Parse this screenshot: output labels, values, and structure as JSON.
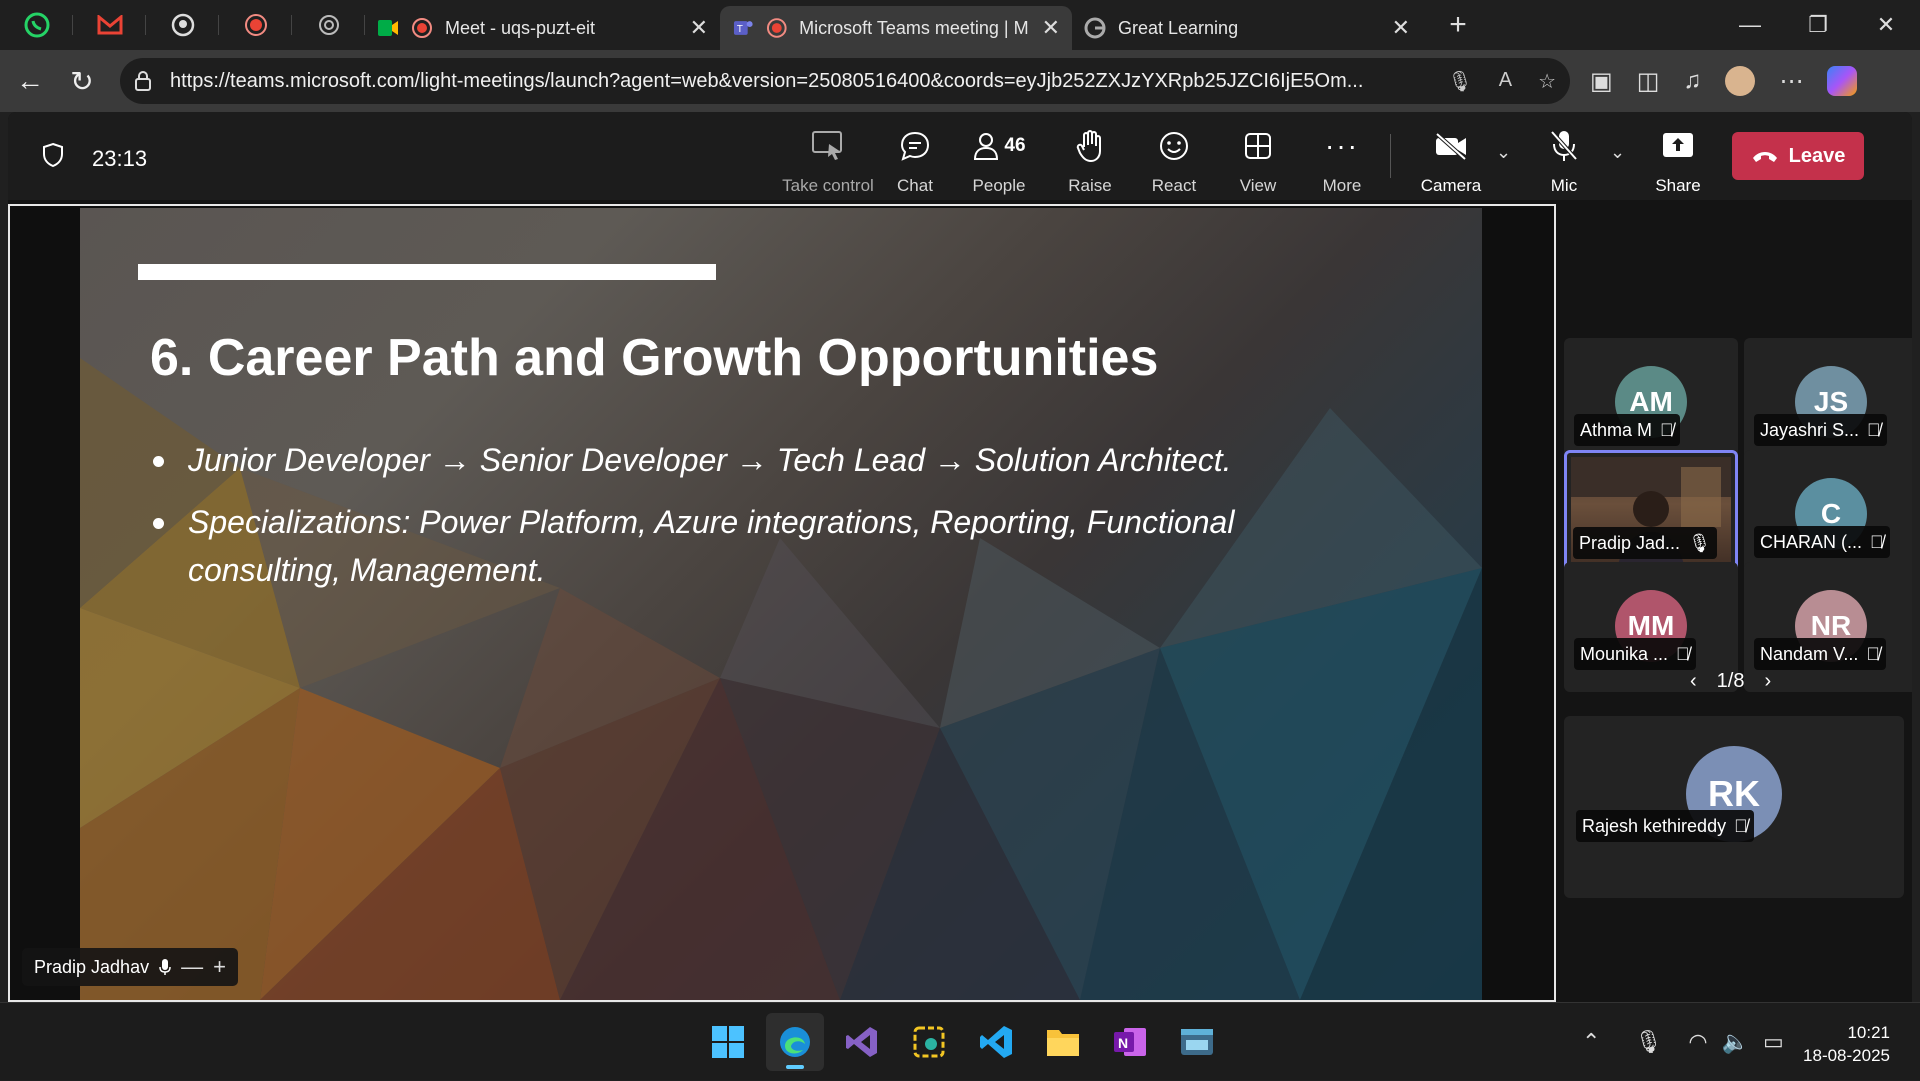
{
  "browser": {
    "tabs": [
      {
        "title": "Meet - uqs-puzt-eit",
        "active": false
      },
      {
        "title": "Microsoft Teams meeting | M",
        "active": true
      },
      {
        "title": "Great Learning",
        "active": false
      }
    ],
    "url": "https://teams.microsoft.com/light-meetings/launch?agent=web&version=25080516400&coords=eyJjb252ZXJzYXRpb25JZCI6IjE5Om..."
  },
  "meeting": {
    "timer": "23:13",
    "controls": {
      "take_control": "Take control",
      "chat": "Chat",
      "people": "People",
      "people_count": "46",
      "raise": "Raise",
      "react": "React",
      "view": "View",
      "more": "More",
      "camera": "Camera",
      "mic": "Mic",
      "share": "Share",
      "leave": "Leave"
    }
  },
  "slide": {
    "heading": "6. Career Path and Growth Opportunities",
    "bullets": [
      "Junior Developer → Senior Developer → Tech Lead → Solution Architect.",
      "Specializations: Power Platform, Azure integrations, Reporting, Functional consulting, Management."
    ],
    "presenter": "Pradip Jadhav"
  },
  "participants": [
    {
      "initials": "AM",
      "name": "Athma M",
      "color": "#5b8a86"
    },
    {
      "initials": "JS",
      "name": "Jayashri S...",
      "color": "#6f8fa0"
    },
    {
      "initials": "",
      "name": "Pradip Jad...",
      "color": "#5b4a3c"
    },
    {
      "initials": "C",
      "name": "CHARAN (...",
      "color": "#5b8fa0"
    },
    {
      "initials": "MM",
      "name": "Mounika ...",
      "color": "#b0556b"
    },
    {
      "initials": "NR",
      "name": "Nandam V...",
      "color": "#b88d93"
    }
  ],
  "pager": "1/8",
  "featured_participant": {
    "initials": "RK",
    "name": "Rajesh kethireddy",
    "color": "#7b8fb5"
  },
  "taskbar": {
    "time": "10:21",
    "date": "18-08-2025"
  }
}
